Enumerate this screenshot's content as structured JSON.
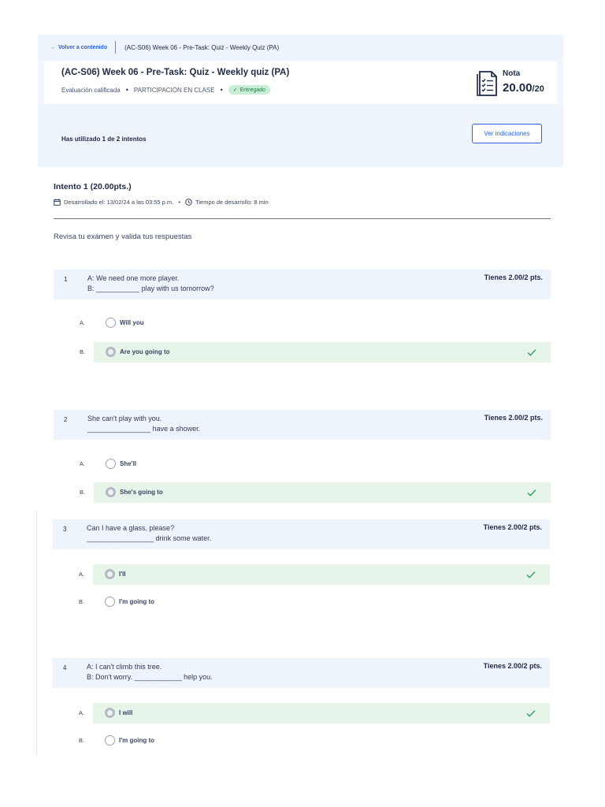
{
  "header": {
    "back_label": "Volver a contenido",
    "breadcrumb": "(AC-S06) Week 06 - Pre-Task: Quiz - Weekly Quiz (PA)"
  },
  "quiz": {
    "title": "(AC-S06) Week 06 - Pre-Task: Quiz - Weekly quiz (PA)",
    "type": "Evaluación calificada",
    "category": "PARTICIPACIÓN EN CLASE",
    "status": "Entregado",
    "grade_label": "Nota",
    "grade_value": "20.00",
    "grade_max": "/20"
  },
  "attempts": {
    "text": "Has utilizado 1 de 2 intentos",
    "button_label": "Ver indicaciones"
  },
  "intento": {
    "title": "Intento 1 (20.00pts.)",
    "date": "Desarrollado el: 13/02/24 a las 03:55 p.m.",
    "duration": "Tiempo de desarrollo: 8 min",
    "instructions": "Revisa tu exámen y valida tus respuestas"
  },
  "questions": [
    {
      "number": "1",
      "line1": "A: We need one more player.",
      "line2": "B: ___________ play with us tomorrow?",
      "score": "Tienes 2.00/2 pts.",
      "options": [
        {
          "letter": "A.",
          "text": "Will you"
        },
        {
          "letter": "B.",
          "text": "Are you going to"
        }
      ]
    },
    {
      "number": "2",
      "line1": "She can't play with you.",
      "line2": "________________ have a shower.",
      "score": "Tienes 2.00/2 pts.",
      "options": [
        {
          "letter": "A.",
          "text": "She'll"
        },
        {
          "letter": "B.",
          "text": "She's going to"
        }
      ]
    },
    {
      "number": "3",
      "line1": "Can I have a glass, please?",
      "line2": "_________________ drink some water.",
      "score": "Tienes 2.00/2 pts.",
      "options": [
        {
          "letter": "A.",
          "text": "I'll"
        },
        {
          "letter": "B.",
          "text": "I'm going to"
        }
      ]
    },
    {
      "number": "4",
      "line1": "A: I can't climb this tree.",
      "line2": "B: Don't worry. ____________ help you.",
      "score": "Tienes 2.00/2 pts.",
      "options": [
        {
          "letter": "A.",
          "text": "I will"
        },
        {
          "letter": "B.",
          "text": "I'm going to"
        }
      ]
    }
  ],
  "colors": {
    "accent": "#2d62d9",
    "correct_bg": "#e6f4ea",
    "check": "#2e9e5b",
    "panel_bg": "#eef4fb"
  }
}
